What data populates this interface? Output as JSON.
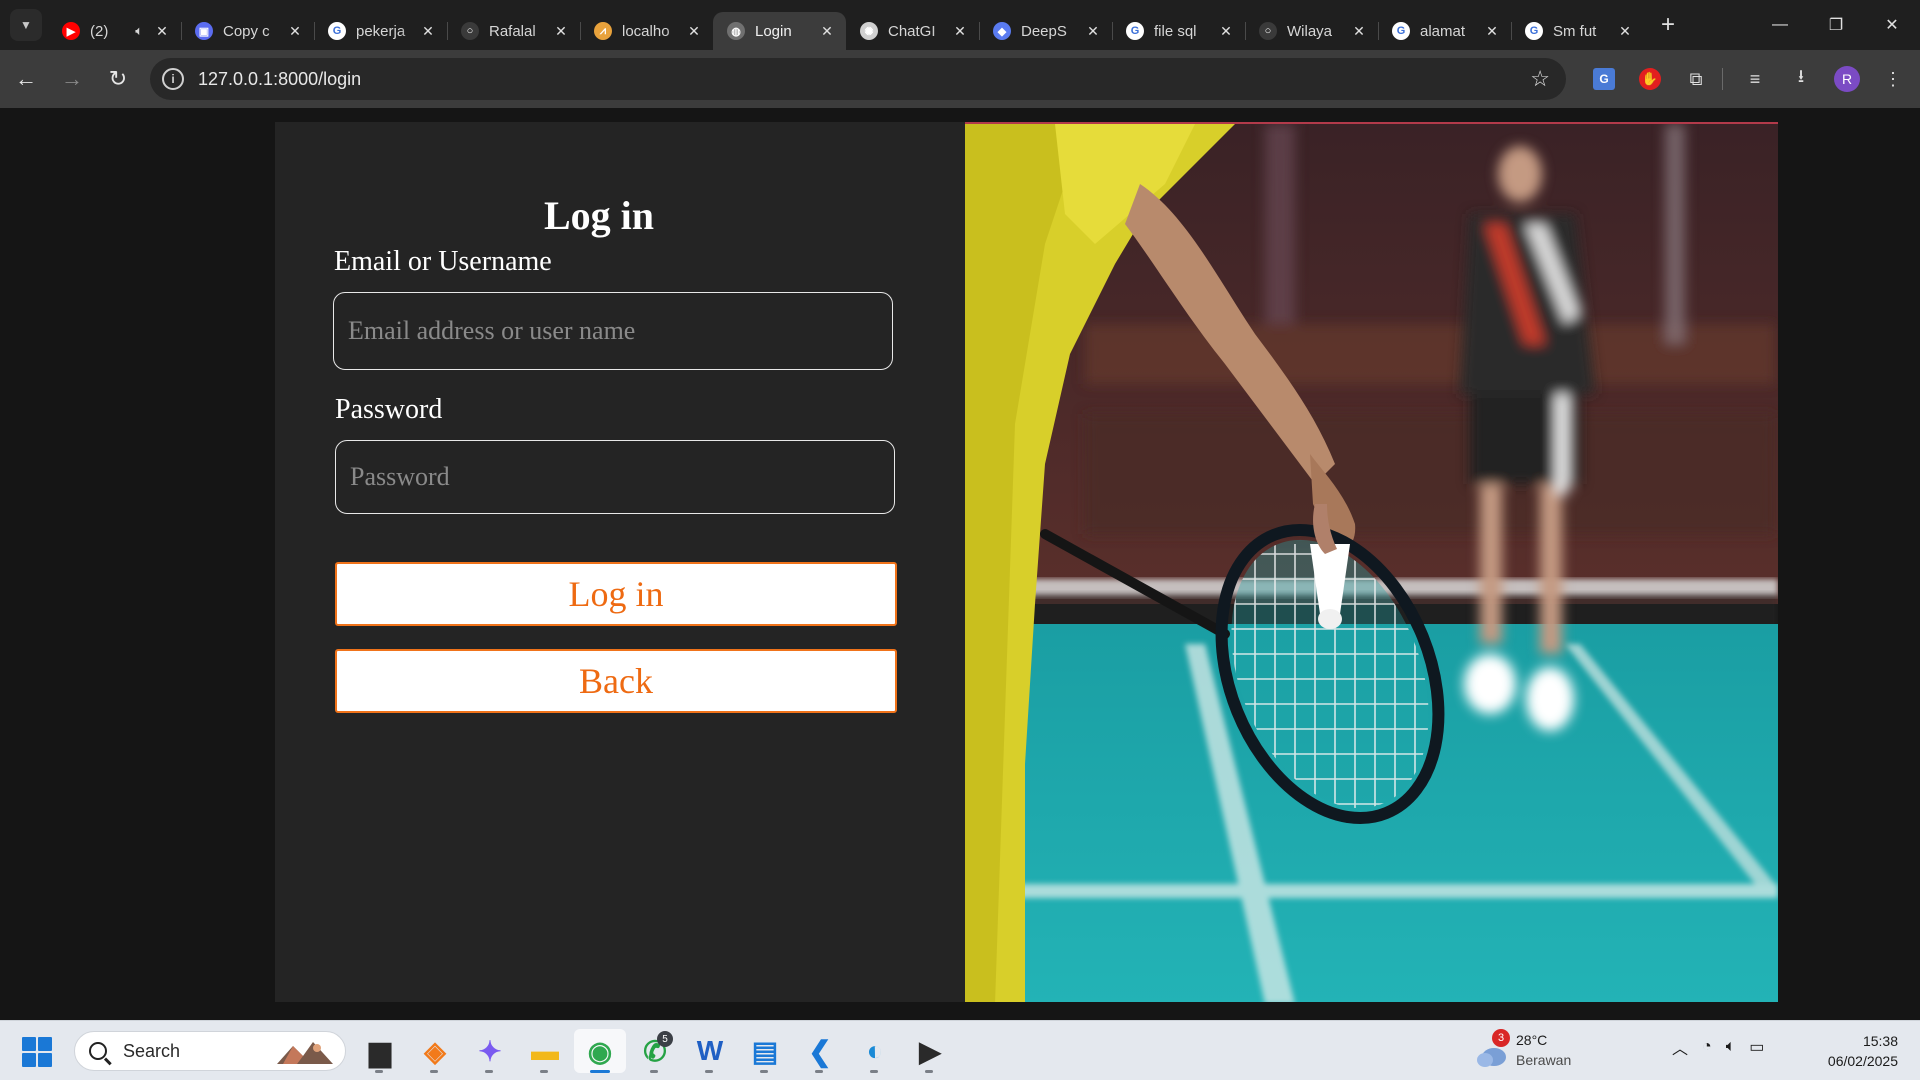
{
  "browser": {
    "tabs": [
      {
        "title": "(2)",
        "favicon": "youtube-icon",
        "color": "#ff0000",
        "glyph": "▶",
        "audio": true
      },
      {
        "title": "Copy c",
        "favicon": "app-icon",
        "color": "#5b6cf0",
        "glyph": "▣"
      },
      {
        "title": "pekerja",
        "favicon": "google-icon",
        "color": "#ffffff",
        "glyph": "G"
      },
      {
        "title": "Rafalal",
        "favicon": "github-icon",
        "color": "#3a3a3a",
        "glyph": "○"
      },
      {
        "title": "localho",
        "favicon": "localhost-icon",
        "color": "#e8a23c",
        "glyph": "⩘"
      },
      {
        "title": "Login",
        "favicon": "globe-icon",
        "color": "#707070",
        "glyph": "◍",
        "active": true
      },
      {
        "title": "ChatGI",
        "favicon": "chatgpt-icon",
        "color": "#d0d0d0",
        "glyph": "✺"
      },
      {
        "title": "DeepS",
        "favicon": "deepseek-icon",
        "color": "#5a7bf0",
        "glyph": "◆"
      },
      {
        "title": "file sql",
        "favicon": "google-icon",
        "color": "#ffffff",
        "glyph": "G"
      },
      {
        "title": "Wilaya",
        "favicon": "github-icon",
        "color": "#3a3a3a",
        "glyph": "○"
      },
      {
        "title": "alamat",
        "favicon": "google-icon",
        "color": "#ffffff",
        "glyph": "G"
      },
      {
        "title": "Sm fut",
        "favicon": "google-icon",
        "color": "#ffffff",
        "glyph": "G"
      }
    ],
    "url": "127.0.0.1:8000/login",
    "profile_initial": "R"
  },
  "login": {
    "title": "Log in",
    "email_label": "Email or Username",
    "email_placeholder": "Email address or user name",
    "password_label": "Password",
    "password_placeholder": "Password",
    "login_button": "Log in",
    "back_button": "Back",
    "accent": "#f0731a"
  },
  "taskbar": {
    "search_label": "Search",
    "apps": [
      {
        "name": "task-view-icon",
        "glyph": "▆",
        "color": "#2a2a2a"
      },
      {
        "name": "brave-icon",
        "glyph": "◈",
        "color": "#f27a1a"
      },
      {
        "name": "copilot-icon",
        "glyph": "✦",
        "color": "#7a5af0"
      },
      {
        "name": "file-explorer-icon",
        "glyph": "▬",
        "color": "#f2b81a"
      },
      {
        "name": "chrome-icon",
        "glyph": "◉",
        "color": "#2fa84f",
        "active": true
      },
      {
        "name": "whatsapp-icon",
        "glyph": "✆",
        "color": "#25a244",
        "badge": "5"
      },
      {
        "name": "word-icon",
        "glyph": "W",
        "color": "#1f5fc4"
      },
      {
        "name": "notepad-icon",
        "glyph": "▤",
        "color": "#1a78d6"
      },
      {
        "name": "vscode-icon",
        "glyph": "❮",
        "color": "#1a78d6"
      },
      {
        "name": "edge-icon",
        "glyph": "◐",
        "color": "#1a8ad6"
      },
      {
        "name": "terminal-icon",
        "glyph": "▶",
        "color": "#2a2a2a"
      }
    ],
    "weather": {
      "badge": "3",
      "temp": "28°C",
      "desc": "Berawan"
    },
    "time": "15:38",
    "date": "06/02/2025"
  }
}
